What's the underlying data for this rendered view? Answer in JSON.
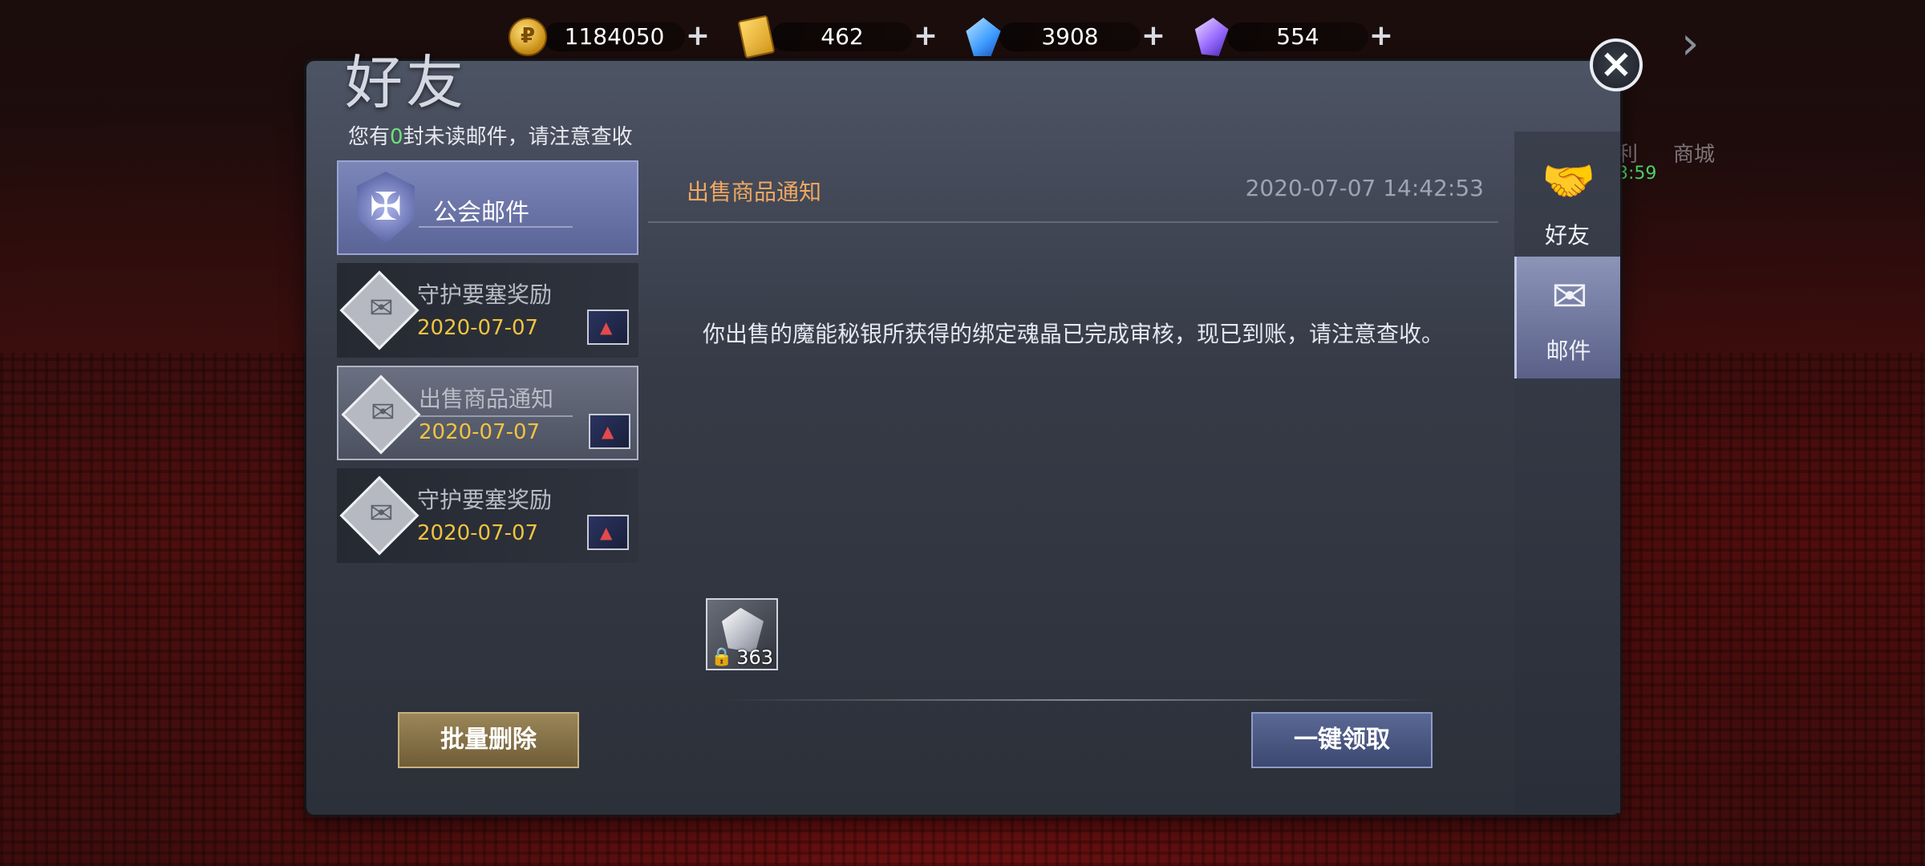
{
  "resources": [
    {
      "icon": "gold-coin-icon",
      "amount": "1184050"
    },
    {
      "icon": "ticket-icon",
      "amount": "462"
    },
    {
      "icon": "blue-crystal-icon",
      "amount": "3908"
    },
    {
      "icon": "purple-crystal-icon",
      "amount": "554"
    }
  ],
  "bg_labels": {
    "shop": "商城",
    "partial": "利",
    "timer": "3:59"
  },
  "panel": {
    "title": "好友",
    "unread_prefix": "您有",
    "unread_count": "0",
    "unread_suffix": "封未读邮件，请注意查收"
  },
  "mail_items": [
    {
      "subject": "公会邮件",
      "date": ""
    },
    {
      "subject": "守护要塞奖励",
      "date": "2020-07-07"
    },
    {
      "subject": "出售商品通知",
      "date": "2020-07-07"
    },
    {
      "subject": "守护要塞奖励",
      "date": "2020-07-07"
    }
  ],
  "batch_delete_label": "批量删除",
  "detail": {
    "title": "出售商品通知",
    "time": "2020-07-07 14:42:53",
    "body": "你出售的魔能秘银所获得的绑定魂晶已完成审核，现已到账，请注意查收。",
    "attachment_qty": "363",
    "claim_label": "一键领取"
  },
  "side_tabs": [
    {
      "icon": "handshake-icon",
      "label": "好友"
    },
    {
      "icon": "mail-icon",
      "label": "邮件"
    }
  ],
  "colors": {
    "accent_orange": "#f0a861",
    "date_yellow": "#f2c340",
    "unread_green": "#6fe07a"
  }
}
